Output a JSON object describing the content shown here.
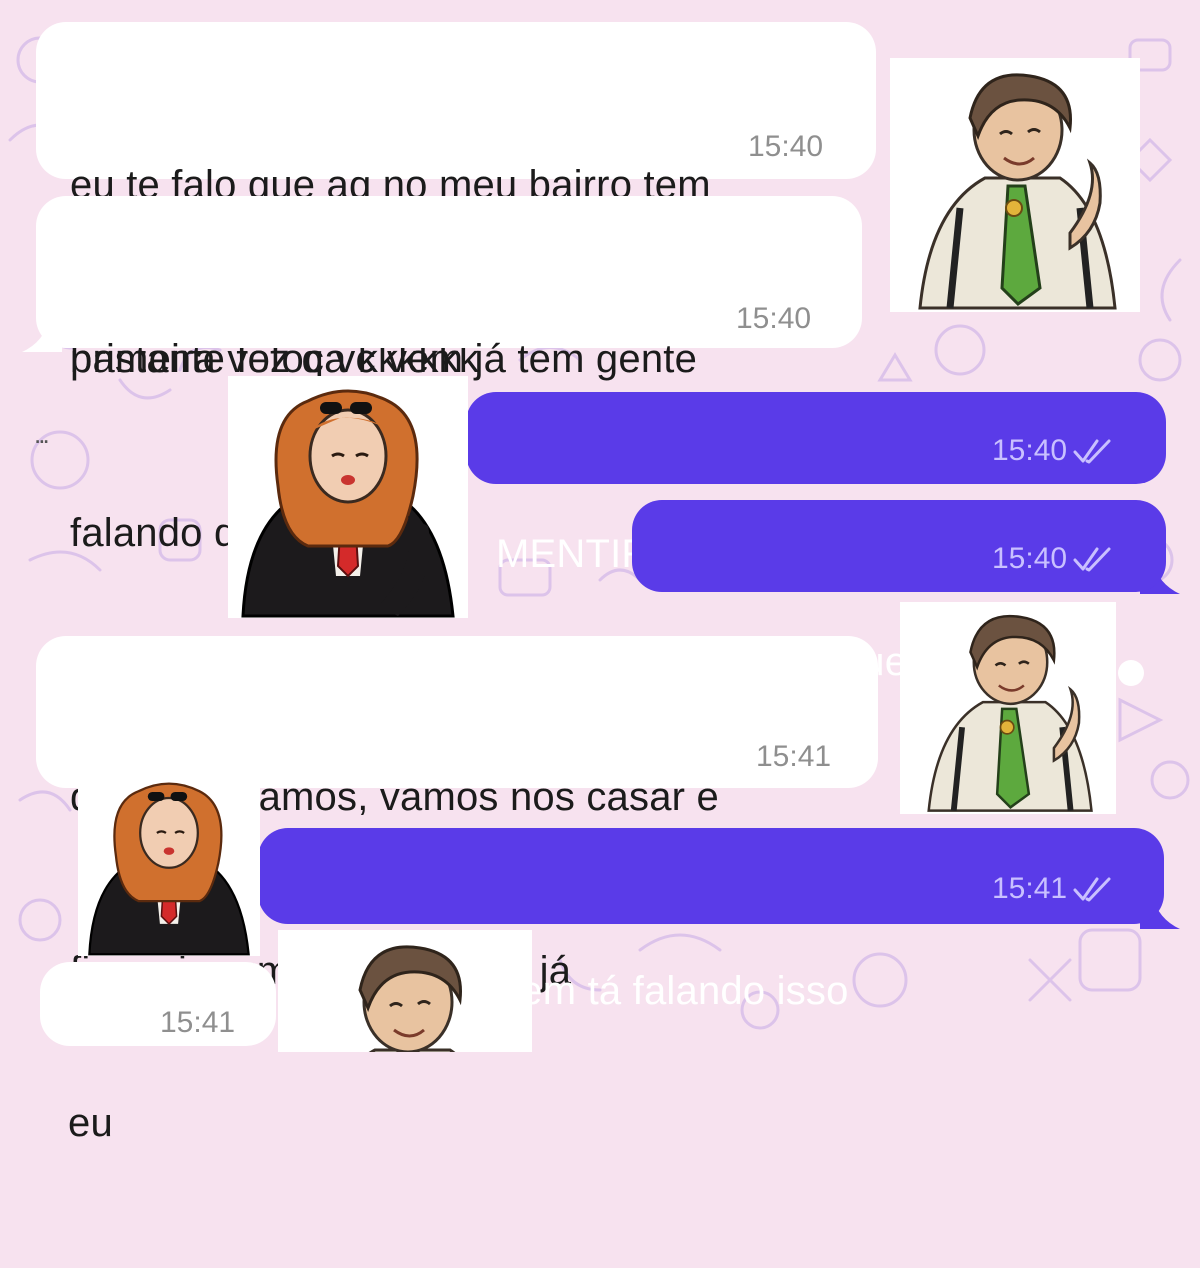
{
  "messages": [
    {
      "id": "m1",
      "side": "in",
      "lines": [
        "eu te falo que aq no meu bairro tem",
        "bastante fofoca kkkkkk"
      ],
      "time": "15:40"
    },
    {
      "id": "m2",
      "side": "in",
      "lines": [
        "primeira vez q vc vem já tem gente",
        "falando de vc"
      ],
      "time": "15:40"
    },
    {
      "id": "m3",
      "side": "out",
      "lines": [
        "MENTIRA KKKKKKKK"
      ],
      "time": "15:40",
      "status": "read"
    },
    {
      "id": "m4",
      "side": "out",
      "lines": [
        "falaram o que"
      ],
      "time": "15:40",
      "status": "read"
    },
    {
      "id": "m5",
      "side": "in",
      "lines": [
        "que se amamos, vamos nos casar e",
        "financiar um apartamento já"
      ],
      "time": "15:41"
    },
    {
      "id": "m6",
      "side": "out",
      "lines": [
        "meu jesus quem tá falando isso"
      ],
      "time": "15:41",
      "status": "read"
    },
    {
      "id": "m7",
      "side": "in",
      "lines": [
        "eu"
      ],
      "time": "15:41"
    }
  ],
  "stickers": [
    {
      "id": "s1",
      "character": "boy-green-tie"
    },
    {
      "id": "s2",
      "character": "girl-red-tie"
    },
    {
      "id": "s3",
      "character": "boy-green-tie"
    },
    {
      "id": "s4",
      "character": "girl-red-tie"
    },
    {
      "id": "s5",
      "character": "boy-green-tie"
    }
  ],
  "ellipsis": "...",
  "colors": {
    "background": "#f7e2ef",
    "incoming_bubble": "#ffffff",
    "outgoing_bubble": "#5a3be8",
    "read_ticks": "#c9c0ff"
  }
}
